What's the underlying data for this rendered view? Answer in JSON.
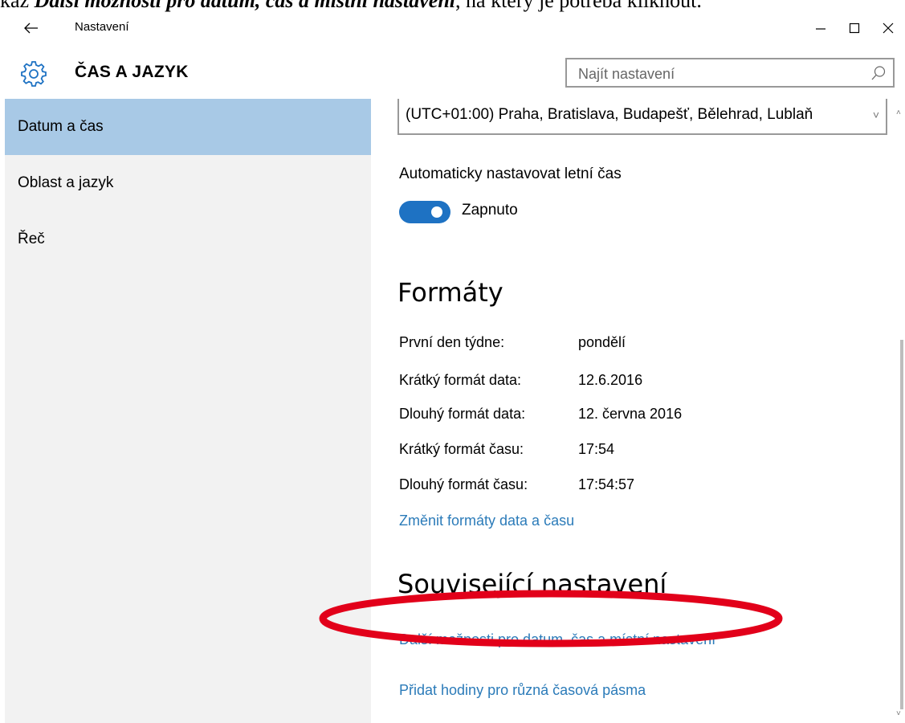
{
  "caption": {
    "prefix": "kaz ",
    "bold_part": "Další možnosti pro datum, čas a místní nastavení",
    "suffix": ", na který je potřeba kliknout."
  },
  "window": {
    "title": "Nastavení",
    "back_icon": "back-arrow-icon",
    "minimize_icon": "minimize-icon",
    "maximize_icon": "maximize-icon",
    "close_icon": "close-icon"
  },
  "header": {
    "icon": "gear-icon",
    "title": "ČAS A JAZYK",
    "search_placeholder": "Najít nastavení"
  },
  "sidebar": {
    "items": [
      {
        "label": "Datum a čas",
        "selected": true
      },
      {
        "label": "Oblast a jazyk",
        "selected": false
      },
      {
        "label": "Řeč",
        "selected": false
      }
    ]
  },
  "content": {
    "timezone_value": "(UTC+01:00) Praha, Bratislava, Budapešť, Bělehrad, Lublaň",
    "dst_label": "Automaticky nastavovat letní čas",
    "dst_toggle_state": "Zapnuto",
    "formats_title": "Formáty",
    "formats": [
      {
        "label": "První den týdne:",
        "value": "pondělí"
      },
      {
        "label": "Krátký formát data:",
        "value": "12.6.2016"
      },
      {
        "label": "Dlouhý formát data:",
        "value": "12. června 2016"
      },
      {
        "label": "Krátký formát času:",
        "value": "17:54"
      },
      {
        "label": "Dlouhý formát času:",
        "value": "17:54:57"
      }
    ],
    "change_formats_link": "Změnit formáty data a času",
    "related_title": "Související nastavení",
    "related_links": [
      "Další možnosti pro datum, čas a místní nastavení",
      "Přidat hodiny pro různá časová pásma"
    ]
  },
  "colors": {
    "accent": "#1e72c3",
    "link": "#2b7bb9",
    "selection": "#a8c9e6",
    "sidebar_bg": "#f2f2f2",
    "annotation": "#e2001a"
  }
}
